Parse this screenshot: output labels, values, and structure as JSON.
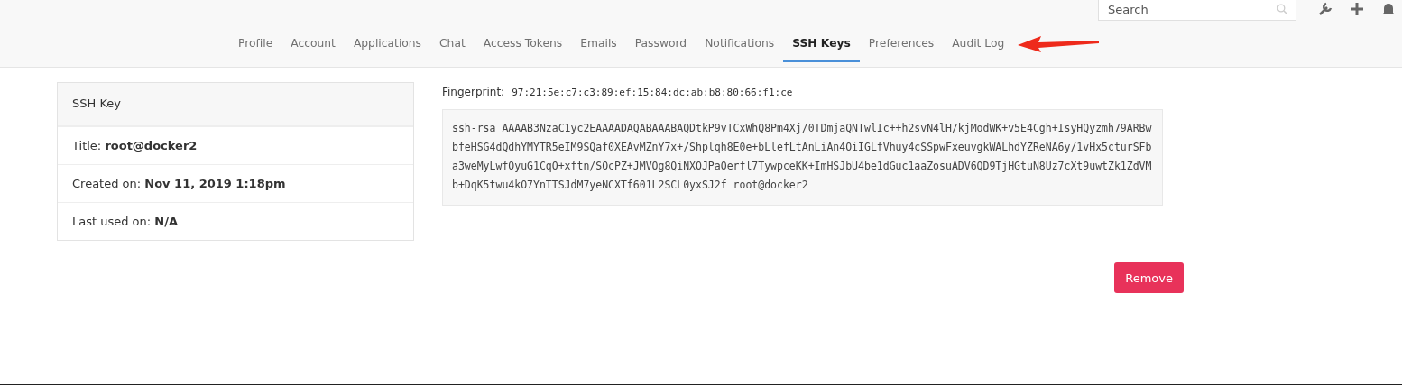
{
  "search": {
    "placeholder": "Search"
  },
  "tabs": [
    {
      "label": "Profile",
      "selected": false
    },
    {
      "label": "Account",
      "selected": false
    },
    {
      "label": "Applications",
      "selected": false
    },
    {
      "label": "Chat",
      "selected": false
    },
    {
      "label": "Access Tokens",
      "selected": false
    },
    {
      "label": "Emails",
      "selected": false
    },
    {
      "label": "Password",
      "selected": false
    },
    {
      "label": "Notifications",
      "selected": false
    },
    {
      "label": "SSH Keys",
      "selected": true
    },
    {
      "label": "Preferences",
      "selected": false
    },
    {
      "label": "Audit Log",
      "selected": false
    }
  ],
  "key_card": {
    "heading": "SSH Key",
    "fields": [
      {
        "label": "Title:",
        "value": "root@docker2"
      },
      {
        "label": "Created on:",
        "value": "Nov 11, 2019 1:18pm"
      },
      {
        "label": "Last used on:",
        "value": "N/A"
      }
    ]
  },
  "fingerprint": {
    "label": "Fingerprint:",
    "value": "97:21:5e:c7:c3:89:ef:15:84:dc:ab:b8:80:66:f1:ce"
  },
  "public_key": "ssh-rsa AAAAB3NzaC1yc2EAAAADAQABAAABAQDtkP9vTCxWhQ8Pm4Xj/0TDmjaQNTwlIc++h2svN4lH/kjModWK+v5E4Cgh+IsyHQyzmh79ARBwbfeHSG4dQdhYMYTR5eIM9SQaf0XEAvMZnY7x+/Shplqh8E0e+bLlefLtAnLiAn4OiIGLfVhuy4cSSpwFxeuvgkWALhdYZReNA6y/1vHx5cturSFba3weMyLwfOyuG1CqO+xftn/SOcPZ+JMVOg8QiNXOJPaOerfl7TywpceKK+ImHSJbU4be1dGuc1aaZosuADV6QD9TjHGtuN8Uz7cXt9uwtZk1ZdVMb+DqK5twu4kO7YnTTSJdM7yeNCXTf601L2SCL0yxSJ2f root@docker2",
  "buttons": [
    {
      "label": "Remove",
      "kind": "danger"
    }
  ]
}
